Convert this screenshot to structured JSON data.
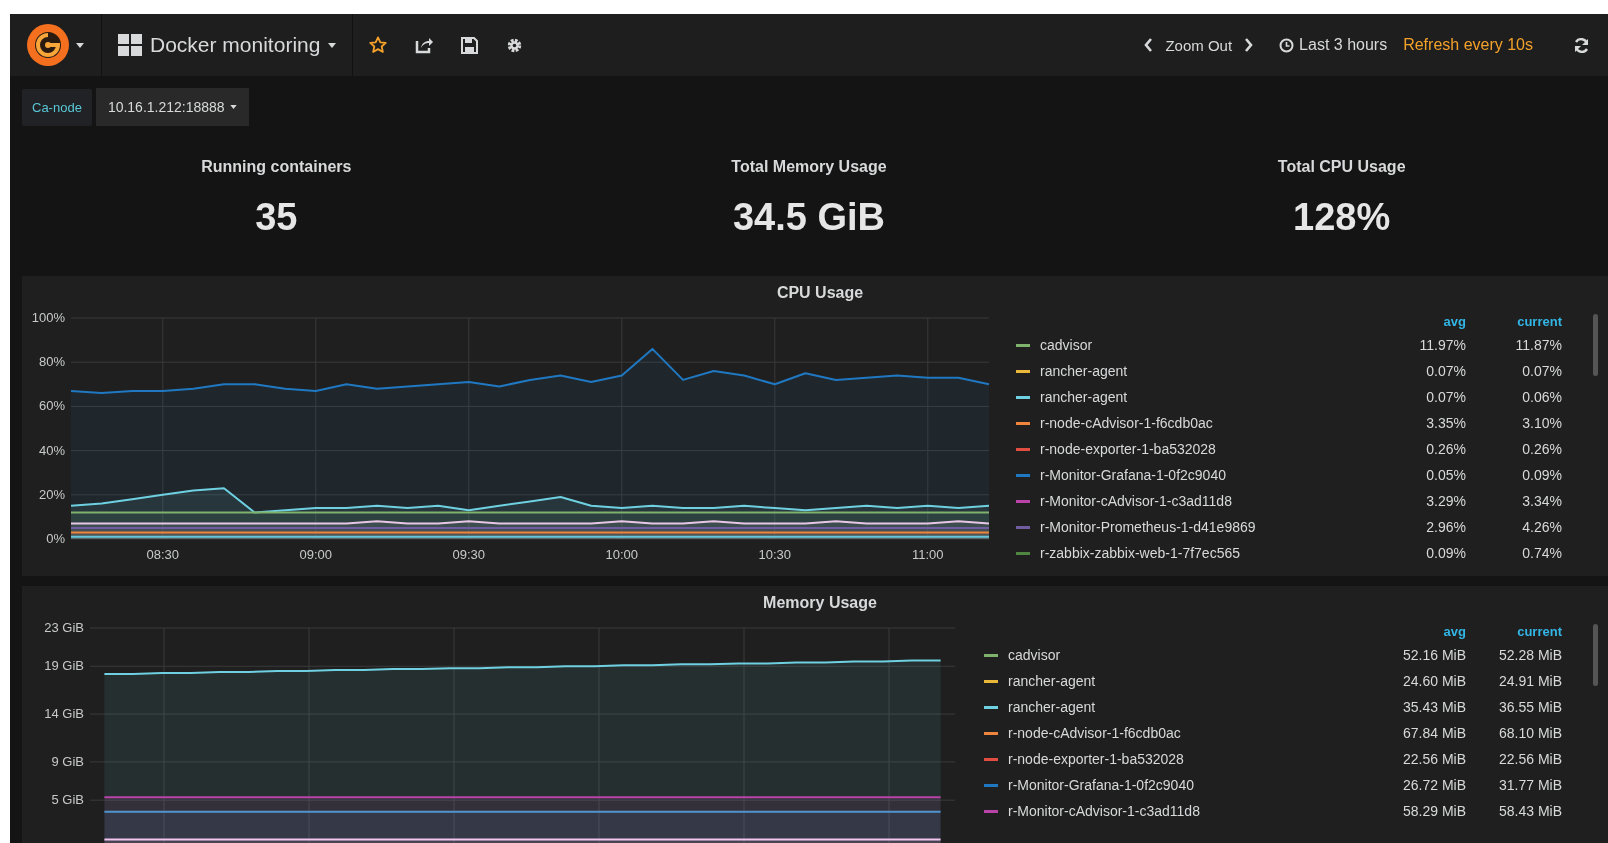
{
  "navbar": {
    "dashboard_title": "Docker monitoring",
    "zoom_out": "Zoom Out",
    "time_range": "Last 3 hours",
    "refresh": "Refresh every 10s"
  },
  "templating": [
    {
      "label": "Ca-node",
      "value": "10.16.1.212:18888"
    }
  ],
  "stats": [
    {
      "title": "Running containers",
      "value": "35"
    },
    {
      "title": "Total Memory Usage",
      "value": "34.5 GiB"
    },
    {
      "title": "Total CPU Usage",
      "value": "128%"
    }
  ],
  "panels": [
    {
      "title": "CPU Usage",
      "chart_data": {
        "type": "area",
        "grid": true,
        "categories": [
          null,
          null,
          null,
          "08:30",
          null,
          null,
          null,
          null,
          "09:00",
          null,
          null,
          null,
          null,
          "09:30",
          null,
          null,
          null,
          null,
          "10:00",
          null,
          null,
          null,
          null,
          "10:30",
          null,
          null,
          null,
          null,
          "11:00",
          null,
          null
        ],
        "ylim": [
          0,
          100
        ],
        "yticks": [
          {
            "value": 0,
            "label": "0%"
          },
          {
            "value": 20,
            "label": "20%"
          },
          {
            "value": 40,
            "label": "40%"
          },
          {
            "value": 60,
            "label": "60%"
          },
          {
            "value": 80,
            "label": "80%"
          },
          {
            "value": 100,
            "label": "100%"
          }
        ],
        "series": [
          {
            "color": "#1f78c1",
            "values": [
              67,
              66,
              67,
              67,
              68,
              70,
              70,
              68,
              67,
              70,
              68,
              69,
              70,
              71,
              69,
              72,
              74,
              71,
              74,
              86,
              72,
              76,
              74,
              70,
              75,
              72,
              73,
              74,
              73,
              73,
              70
            ]
          },
          {
            "color": "#6ed0e0",
            "values": [
              15,
              16,
              18,
              20,
              22,
              23,
              12,
              13,
              14,
              14,
              15,
              14,
              15,
              13,
              15,
              17,
              19,
              15,
              14,
              15,
              14,
              14,
              15,
              14,
              13,
              14,
              15,
              14,
              15,
              14,
              15
            ]
          },
          {
            "color": "#7eb26d",
            "values": [
              12,
              12,
              12,
              12,
              12,
              12,
              12,
              12,
              12,
              12,
              12,
              12,
              12,
              12,
              12,
              12,
              12,
              12,
              12,
              12,
              12,
              12,
              12,
              12,
              12,
              12,
              12,
              12,
              12,
              12,
              12
            ]
          },
          {
            "color": "#e8c6e6",
            "values": [
              7,
              7,
              7,
              7,
              7,
              7,
              7,
              7,
              7,
              7,
              8,
              7,
              7,
              8,
              7,
              7,
              7,
              7,
              8,
              7,
              7,
              8,
              7,
              7,
              7,
              8,
              7,
              7,
              7,
              8,
              7
            ]
          },
          {
            "color": "#705da0",
            "values": [
              5,
              5,
              5,
              5,
              5,
              5,
              5,
              5,
              5,
              5,
              5,
              5,
              5,
              5,
              5,
              5,
              5,
              5,
              5,
              5,
              5,
              5,
              5,
              5,
              5,
              5,
              5,
              5,
              5,
              5,
              5
            ]
          },
          {
            "color": "#ef843c",
            "values": [
              3,
              3,
              3,
              3,
              3,
              3,
              3,
              3,
              3,
              3,
              3,
              3,
              3,
              3,
              3,
              3,
              3,
              3,
              3,
              3,
              3,
              3,
              3,
              3,
              3,
              3,
              3,
              3,
              3,
              3,
              3
            ]
          },
          {
            "color": "#65c5db",
            "values": [
              1,
              1,
              1,
              1,
              1,
              1,
              1,
              1,
              1,
              1,
              1,
              1,
              1,
              1,
              1,
              1,
              1,
              1,
              1,
              1,
              1,
              1,
              1,
              1,
              1,
              1,
              1,
              1,
              1,
              1,
              1
            ]
          }
        ]
      },
      "legend": {
        "columns": [
          "avg",
          "current"
        ],
        "rows": [
          {
            "name": "cadvisor",
            "color": "#7eb26d",
            "values": [
              "11.97%",
              "11.87%"
            ]
          },
          {
            "name": "rancher-agent",
            "color": "#eab839",
            "values": [
              "0.07%",
              "0.07%"
            ]
          },
          {
            "name": "rancher-agent",
            "color": "#6ed0e0",
            "values": [
              "0.07%",
              "0.06%"
            ]
          },
          {
            "name": "r-node-cAdvisor-1-f6cdb0ac",
            "color": "#ef843c",
            "values": [
              "3.35%",
              "3.10%"
            ]
          },
          {
            "name": "r-node-exporter-1-ba532028",
            "color": "#e24d42",
            "values": [
              "0.26%",
              "0.26%"
            ]
          },
          {
            "name": "r-Monitor-Grafana-1-0f2c9040",
            "color": "#1f78c1",
            "values": [
              "0.05%",
              "0.09%"
            ]
          },
          {
            "name": "r-Monitor-cAdvisor-1-c3ad11d8",
            "color": "#ba43a9",
            "values": [
              "3.29%",
              "3.34%"
            ]
          },
          {
            "name": "r-Monitor-Prometheus-1-d41e9869",
            "color": "#705da0",
            "values": [
              "2.96%",
              "4.26%"
            ]
          },
          {
            "name": "r-zabbix-zabbix-web-1-7f7ec565",
            "color": "#508642",
            "values": [
              "0.09%",
              "0.74%"
            ]
          }
        ]
      }
    },
    {
      "title": "Memory Usage",
      "chart_data": {
        "type": "area",
        "grid": true,
        "categories": [
          null,
          null,
          null,
          null,
          null,
          null,
          null,
          null,
          null,
          null,
          null,
          null,
          null,
          null,
          null,
          null,
          null,
          null,
          null,
          null,
          null,
          null,
          null,
          null,
          null,
          null,
          null,
          null,
          null,
          null
        ],
        "ylim": [
          0,
          23
        ],
        "yticks": [
          {
            "value": 5,
            "label": "5 GiB"
          },
          {
            "value": 9,
            "label": "9 GiB"
          },
          {
            "value": 14,
            "label": "14 GiB"
          },
          {
            "value": 19,
            "label": "19 GiB"
          },
          {
            "value": 23,
            "label": "23 GiB"
          }
        ],
        "series": [
          {
            "color": "#6ed0e0",
            "values": [
              18.2,
              18.2,
              18.3,
              18.3,
              18.4,
              18.4,
              18.5,
              18.5,
              18.6,
              18.6,
              18.7,
              18.7,
              18.8,
              18.8,
              18.9,
              18.9,
              19.0,
              19.0,
              19.1,
              19.1,
              19.2,
              19.2,
              19.3,
              19.3,
              19.4,
              19.4,
              19.5,
              19.5,
              19.6,
              19.6
            ]
          },
          {
            "color": "#ba43a9",
            "values": [
              5.3,
              5.3,
              5.3,
              5.3,
              5.3,
              5.3,
              5.3,
              5.3,
              5.3,
              5.3,
              5.3,
              5.3,
              5.3,
              5.3,
              5.3,
              5.3,
              5.3,
              5.3,
              5.3,
              5.3,
              5.3,
              5.3,
              5.3,
              5.3,
              5.3,
              5.3,
              5.3,
              5.3,
              5.3,
              5.3
            ]
          },
          {
            "color": "#5195ce",
            "values": [
              3.8,
              3.8,
              3.8,
              3.8,
              3.8,
              3.8,
              3.8,
              3.8,
              3.8,
              3.8,
              3.8,
              3.8,
              3.8,
              3.8,
              3.8,
              3.8,
              3.8,
              3.8,
              3.8,
              3.8,
              3.8,
              3.8,
              3.8,
              3.8,
              3.8,
              3.8,
              3.8,
              3.8,
              3.8,
              3.8
            ]
          },
          {
            "color": "#f2c6ee",
            "values": [
              0.9,
              0.9,
              0.9,
              0.9,
              0.9,
              0.9,
              0.9,
              0.9,
              0.9,
              0.9,
              0.9,
              0.9,
              0.9,
              0.9,
              0.9,
              0.9,
              0.9,
              0.9,
              0.9,
              0.9,
              0.9,
              0.9,
              0.9,
              0.9,
              0.9,
              0.9,
              0.9,
              0.9,
              0.9,
              0.9
            ]
          }
        ]
      },
      "legend": {
        "columns": [
          "avg",
          "current"
        ],
        "rows": [
          {
            "name": "cadvisor",
            "color": "#7eb26d",
            "values": [
              "52.16 MiB",
              "52.28 MiB"
            ]
          },
          {
            "name": "rancher-agent",
            "color": "#eab839",
            "values": [
              "24.60 MiB",
              "24.91 MiB"
            ]
          },
          {
            "name": "rancher-agent",
            "color": "#6ed0e0",
            "values": [
              "35.43 MiB",
              "36.55 MiB"
            ]
          },
          {
            "name": "r-node-cAdvisor-1-f6cdb0ac",
            "color": "#ef843c",
            "values": [
              "67.84 MiB",
              "68.10 MiB"
            ]
          },
          {
            "name": "r-node-exporter-1-ba532028",
            "color": "#e24d42",
            "values": [
              "22.56 MiB",
              "22.56 MiB"
            ]
          },
          {
            "name": "r-Monitor-Grafana-1-0f2c9040",
            "color": "#1f78c1",
            "values": [
              "26.72 MiB",
              "31.77 MiB"
            ]
          },
          {
            "name": "r-Monitor-cAdvisor-1-c3ad11d8",
            "color": "#ba43a9",
            "values": [
              "58.29 MiB",
              "58.43 MiB"
            ]
          }
        ]
      }
    }
  ]
}
